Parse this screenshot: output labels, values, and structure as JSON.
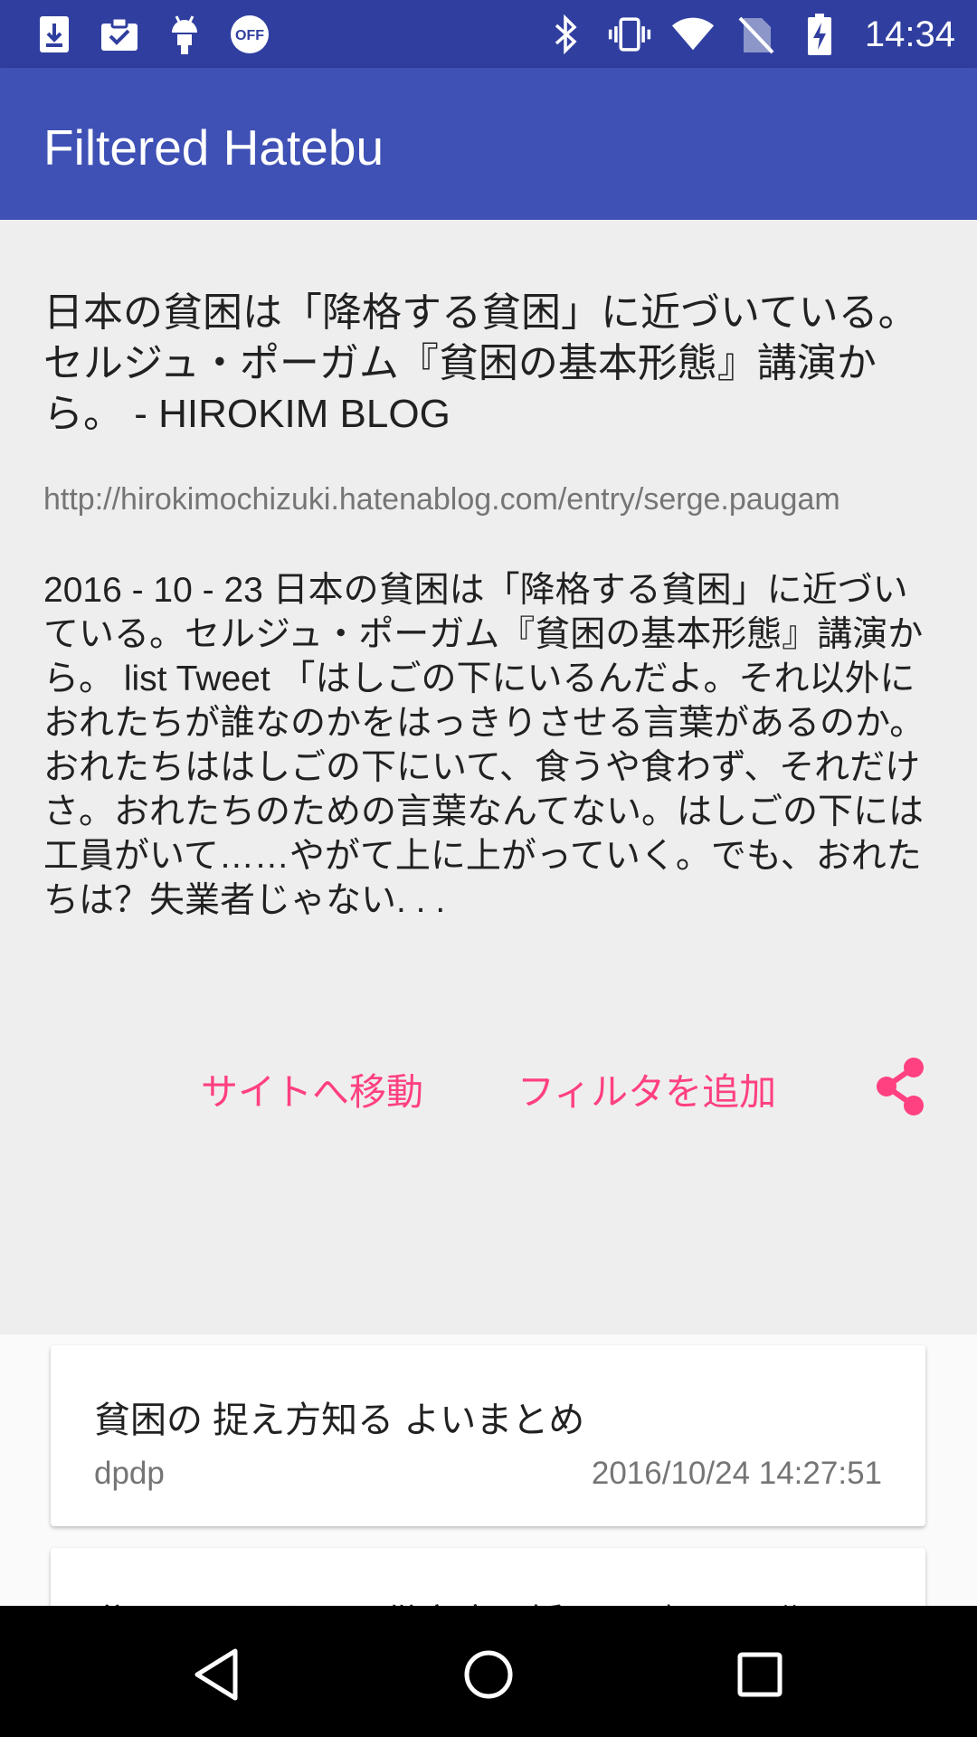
{
  "status_bar": {
    "time": "14:34",
    "left_icons": [
      "download-icon",
      "clipboard-check-icon",
      "android-icon",
      "off-badge-icon"
    ],
    "right_icons": [
      "bluetooth-icon",
      "vibrate-icon",
      "wifi-icon",
      "no-sim-icon",
      "battery-charging-icon"
    ],
    "off_label": "OFF"
  },
  "app_bar": {
    "title": "Filtered Hatebu"
  },
  "entry": {
    "title": "日本の貧困は「降格する貧困」に近づいている。セルジュ・ポーガム『貧困の基本形態』講演から。 - HIROKIM BLOG",
    "url": "http://hirokimochizuki.hatenablog.com/entry/serge.paugam",
    "summary": "2016 - 10 - 23 日本の貧困は「降格する貧困」に近づいている。セルジュ・ポーガム『貧困の基本形態』講演から。 list Tweet 「はしごの下にいるんだよ。それ以外におれたちが誰なのかをはっきりさせる言葉があるのか。おれたちははしごの下にいて、食うや食わず、それだけさ。おれたちのための言葉なんてない。はしごの下には工員がいて……やがて上に上がっていく。でも、おれたちは？失業者じゃない. . ."
  },
  "actions": {
    "open_site": "サイトへ移動",
    "add_filter": "フィルタを追加",
    "share_icon": "share-icon"
  },
  "comments": [
    {
      "text": "貧困の 捉え方知る よいまとめ",
      "user": "dpdp",
      "date": "2016/10/24 14:27:51"
    },
    {
      "text": "貧困はうになる子供家庭の婚いとが一面に犯ん",
      "user": "",
      "date": ""
    }
  ],
  "nav": [
    "back-icon",
    "home-icon",
    "recents-icon"
  ],
  "colors": {
    "primary": "#3f51b5",
    "primary_dark": "#303f9f",
    "accent": "#ff4081"
  }
}
